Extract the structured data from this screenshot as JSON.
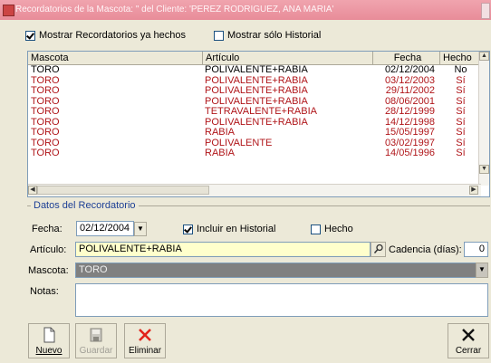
{
  "window": {
    "title": "Recordatorios de la Mascota: \" del Cliente: 'PEREZ RODRIGUEZ, ANA MARIA'"
  },
  "options": {
    "show_done": {
      "label": "Mostrar Recordatorios ya hechos",
      "checked": true
    },
    "history_only": {
      "label": "Mostrar sólo Historial",
      "checked": false
    }
  },
  "table": {
    "headers": [
      "Mascota",
      "Artículo",
      "Fecha",
      "Hecho"
    ],
    "rows": [
      {
        "mascota": "TORO",
        "articulo": "POLIVALENTE+RABIA",
        "fecha": "02/12/2004",
        "hecho": "No"
      },
      {
        "mascota": "TORO",
        "articulo": "POLIVALENTE+RABIA",
        "fecha": "03/12/2003",
        "hecho": "Sí"
      },
      {
        "mascota": "TORO",
        "articulo": "POLIVALENTE+RABIA",
        "fecha": "29/11/2002",
        "hecho": "Sí"
      },
      {
        "mascota": "TORO",
        "articulo": "POLIVALENTE+RABIA",
        "fecha": "08/06/2001",
        "hecho": "Sí"
      },
      {
        "mascota": "TORO",
        "articulo": "TETRAVALENTE+RABIA",
        "fecha": "28/12/1999",
        "hecho": "Sí"
      },
      {
        "mascota": "TORO",
        "articulo": "POLIVALENTE+RABIA",
        "fecha": "14/12/1998",
        "hecho": "Sí"
      },
      {
        "mascota": "TORO",
        "articulo": "RABIA",
        "fecha": "15/05/1997",
        "hecho": "Sí"
      },
      {
        "mascota": "TORO",
        "articulo": "POLIVALENTE",
        "fecha": "03/02/1997",
        "hecho": "Sí"
      },
      {
        "mascota": "TORO",
        "articulo": "RABIA",
        "fecha": "14/05/1996",
        "hecho": "Sí"
      }
    ]
  },
  "details": {
    "legend": "Datos del Recordatorio",
    "fecha_label": "Fecha:",
    "fecha_value": "02/12/2004",
    "incluir_historial": {
      "label": "Incluir en Historial",
      "checked": true
    },
    "hecho": {
      "label": "Hecho",
      "checked": false
    },
    "articulo_label": "Artículo:",
    "articulo_value": "POLIVALENTE+RABIA",
    "cadencia_label": "Cadencia (días):",
    "cadencia_value": "0",
    "mascota_label": "Mascota:",
    "mascota_value": "TORO",
    "notas_label": "Notas:",
    "notas_value": ""
  },
  "toolbar": {
    "nuevo": "Nuevo",
    "guardar": "Guardar",
    "eliminar": "Eliminar",
    "cerrar": "Cerrar"
  },
  "colors": {
    "titlebar": "#e88c99",
    "done_row_text": "#b0161a",
    "articulo_field": "#ffffcc",
    "mascota_field": "#808080"
  }
}
